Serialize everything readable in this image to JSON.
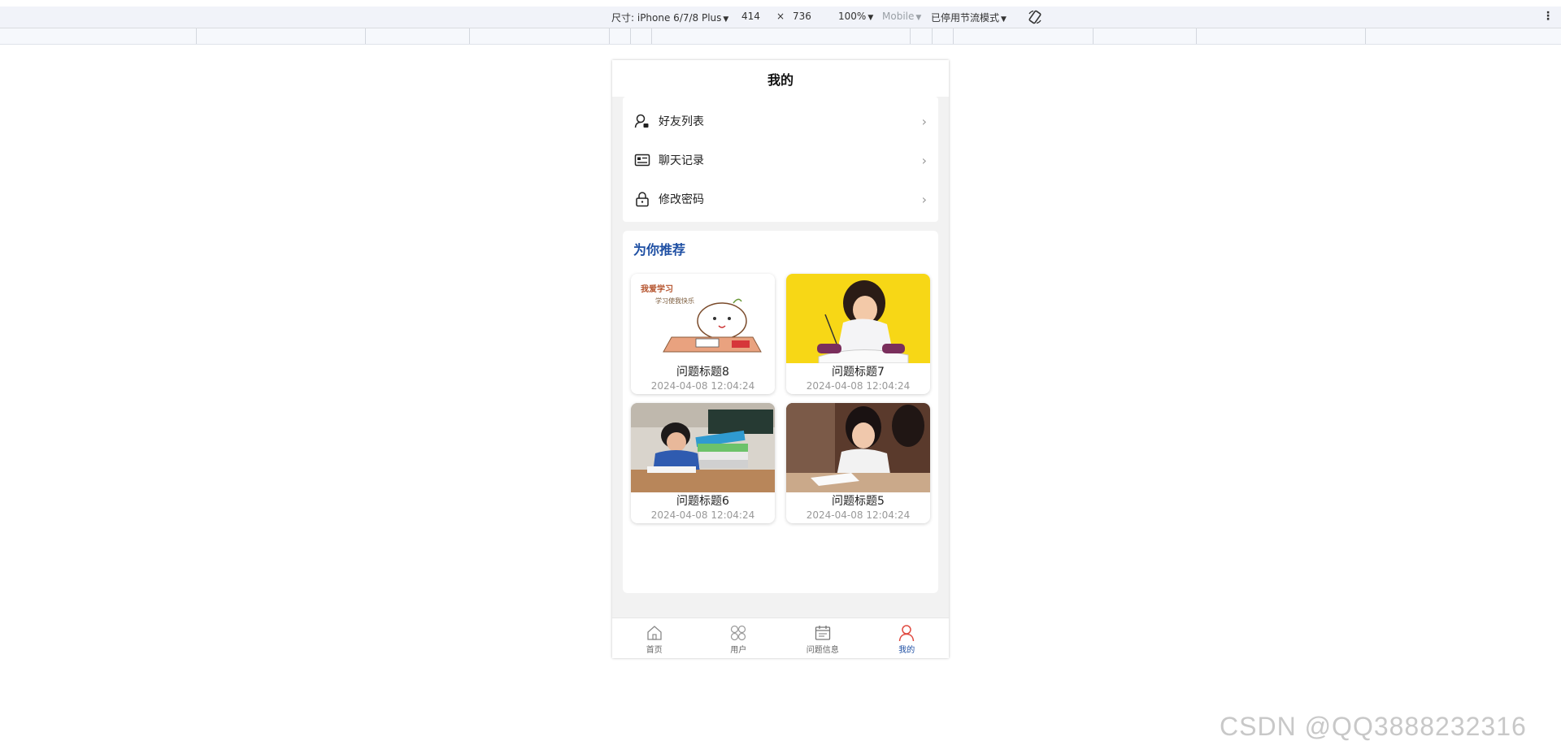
{
  "devtools": {
    "size_label": "尺寸: iPhone 6/7/8 Plus",
    "width": "414",
    "times": "×",
    "height": "736",
    "zoom": "100%",
    "mode": "Mobile",
    "throttle": "已停用节流模式",
    "rotate_icon": "rotate-icon",
    "more_icon": "kebab-icon"
  },
  "app": {
    "title": "我的",
    "menu": [
      {
        "label": "好友列表",
        "icon": "user-list-icon"
      },
      {
        "label": "聊天记录",
        "icon": "chat-record-icon"
      },
      {
        "label": "修改密码",
        "icon": "lock-icon"
      }
    ],
    "recommend": {
      "title": "为你推荐",
      "posts": [
        {
          "title": "问题标题8",
          "date": "2024-04-08 12:04:24",
          "thumb_text_1": "我爱学习",
          "thumb_text_2": "学习使我快乐"
        },
        {
          "title": "问题标题7",
          "date": "2024-04-08 12:04:24"
        },
        {
          "title": "问题标题6",
          "date": "2024-04-08 12:04:24"
        },
        {
          "title": "问题标题5",
          "date": "2024-04-08 12:04:24"
        }
      ]
    },
    "tabs": [
      {
        "label": "首页",
        "icon": "home-icon",
        "active": false
      },
      {
        "label": "用户",
        "icon": "grid-icon",
        "active": false
      },
      {
        "label": "问题信息",
        "icon": "calendar-icon",
        "active": false
      },
      {
        "label": "我的",
        "icon": "person-icon",
        "active": true
      }
    ]
  },
  "colors": {
    "accent": "#1e4fa3",
    "active_tab_icon": "#e0493f"
  },
  "watermark": "CSDN @QQ3888232316"
}
